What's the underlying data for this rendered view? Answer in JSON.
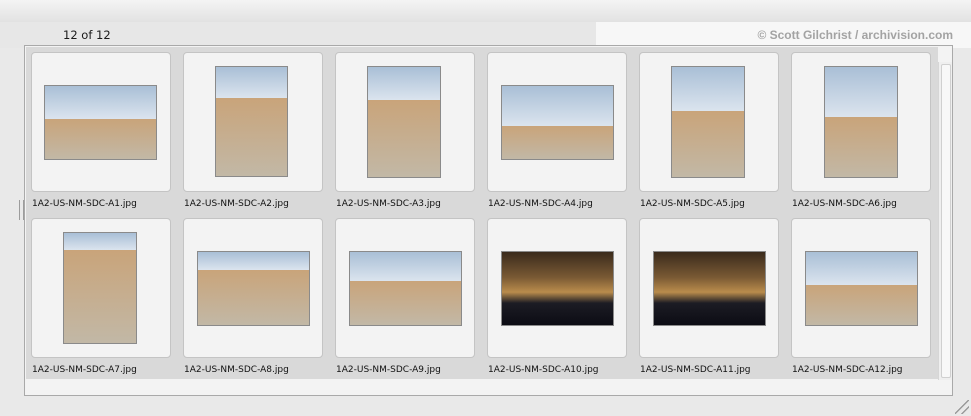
{
  "counter": "12 of 12",
  "copyright": "© Scott Gilchrist / archivision.com",
  "thumbnails": [
    {
      "filename": "1A2-US-NM-SDC-A1.jpg",
      "icon": "courtyard-photo"
    },
    {
      "filename": "1A2-US-NM-SDC-A2.jpg",
      "icon": "adobe-arch-photo"
    },
    {
      "filename": "1A2-US-NM-SDC-A3.jpg",
      "icon": "church-facade-photo"
    },
    {
      "filename": "1A2-US-NM-SDC-A4.jpg",
      "icon": "church-hillside-photo"
    },
    {
      "filename": "1A2-US-NM-SDC-A5.jpg",
      "icon": "church-towers-photo"
    },
    {
      "filename": "1A2-US-NM-SDC-A6.jpg",
      "icon": "bell-tower-photo"
    },
    {
      "filename": "1A2-US-NM-SDC-A7.jpg",
      "icon": "adobe-wall-photo"
    },
    {
      "filename": "1A2-US-NM-SDC-A8.jpg",
      "icon": "vigas-photo"
    },
    {
      "filename": "1A2-US-NM-SDC-A9.jpg",
      "icon": "plaza-photo"
    },
    {
      "filename": "1A2-US-NM-SDC-A10.jpg",
      "icon": "interior-crowd-photo"
    },
    {
      "filename": "1A2-US-NM-SDC-A11.jpg",
      "icon": "altar-photo"
    },
    {
      "filename": "1A2-US-NM-SDC-A12.jpg",
      "icon": "landscape-photo"
    }
  ],
  "colors": {
    "sky": "#a9bfd6",
    "adobe": "#c9a47a",
    "ground": "#c2b8a6"
  }
}
